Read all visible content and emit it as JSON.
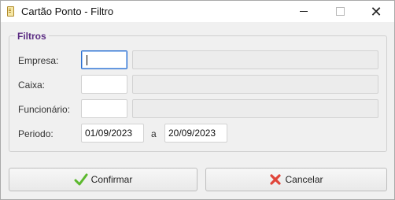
{
  "window": {
    "title": "Cartão Ponto - Filtro",
    "controls": {
      "close": "✕"
    }
  },
  "filters": {
    "group_title": "Filtros",
    "empresa": {
      "label": "Empresa:",
      "code": "",
      "name": ""
    },
    "caixa": {
      "label": "Caixa:",
      "code": "",
      "name": ""
    },
    "funcionario": {
      "label": "Funcionário:",
      "code": "",
      "name": ""
    },
    "periodo": {
      "label": "Periodo:",
      "start": "01/09/2023",
      "separator": "a",
      "end": "20/09/2023"
    }
  },
  "actions": {
    "confirm_label": "Confirmar",
    "cancel_label": "Cancelar"
  },
  "colors": {
    "group_title": "#5b2c83",
    "focus_border": "#2b6fd1",
    "confirm_icon": "#5cb82e",
    "cancel_icon": "#e0453a"
  },
  "icons": {
    "app": "document-icon",
    "confirm": "check-icon",
    "cancel": "x-icon"
  }
}
